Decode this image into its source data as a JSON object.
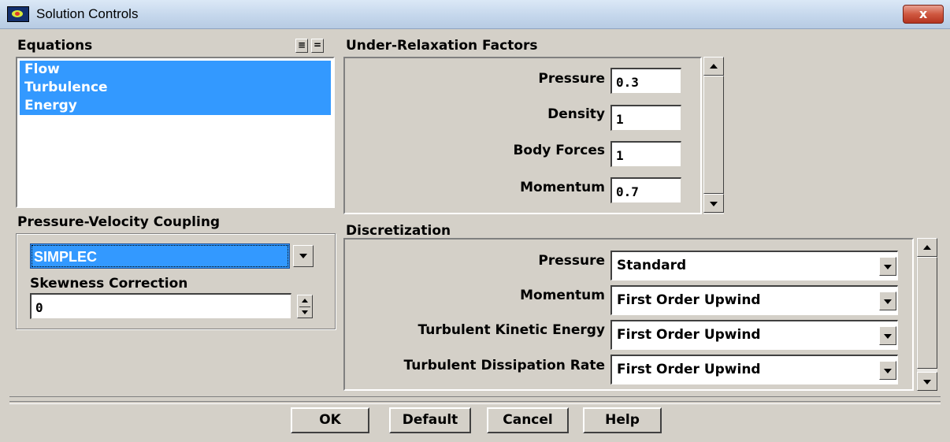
{
  "window": {
    "title": "Solution Controls",
    "close_label": "x",
    "close_icon": "close-icon"
  },
  "equations": {
    "label": "Equations",
    "select_all_label": "≡",
    "deselect_all_label": "=",
    "items": [
      "Flow",
      "Turbulence",
      "Energy"
    ]
  },
  "urf": {
    "label": "Under-Relaxation Factors",
    "fields": [
      {
        "label": "Pressure",
        "value": "0.3"
      },
      {
        "label": "Density",
        "value": "1"
      },
      {
        "label": "Body Forces",
        "value": "1"
      },
      {
        "label": "Momentum",
        "value": "0.7"
      }
    ]
  },
  "pvc": {
    "label": "Pressure-Velocity Coupling",
    "scheme": "SIMPLEC",
    "skewness_label": "Skewness Correction",
    "skewness_value": "0"
  },
  "discretization": {
    "label": "Discretization",
    "rows": [
      {
        "label": "Pressure",
        "value": "Standard"
      },
      {
        "label": "Momentum",
        "value": "First Order Upwind"
      },
      {
        "label": "Turbulent Kinetic Energy",
        "value": "First Order Upwind"
      },
      {
        "label": "Turbulent Dissipation Rate",
        "value": "First Order Upwind"
      }
    ]
  },
  "buttons": {
    "ok": "OK",
    "default": "Default",
    "cancel": "Cancel",
    "help": "Help"
  },
  "colors": {
    "selection": "#3399ff",
    "dialog_bg": "#d4d0c8"
  }
}
